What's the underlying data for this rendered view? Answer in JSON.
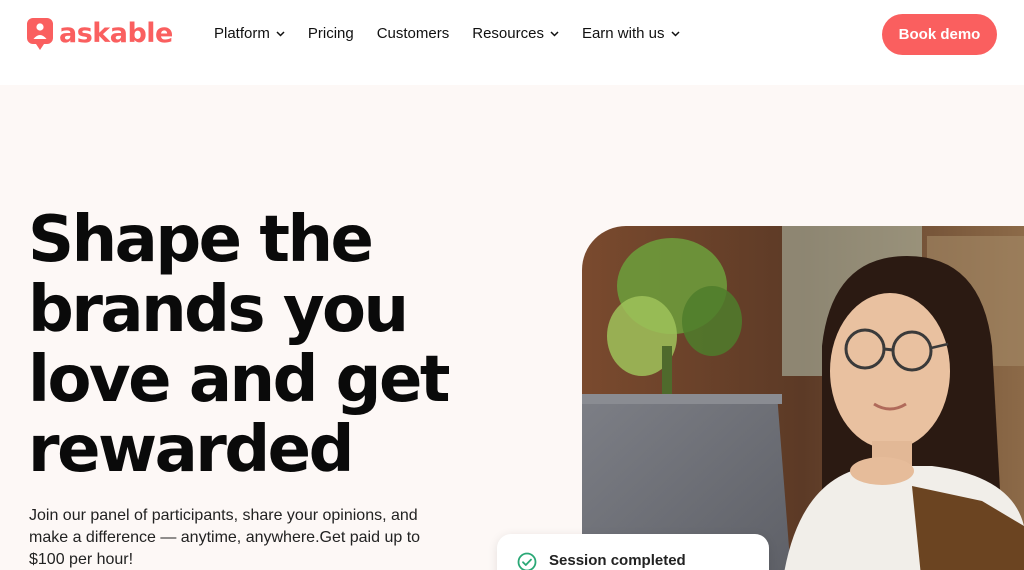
{
  "header": {
    "logo_text": "askable",
    "nav": [
      {
        "label": "Platform",
        "has_dropdown": true
      },
      {
        "label": "Pricing",
        "has_dropdown": false
      },
      {
        "label": "Customers",
        "has_dropdown": false
      },
      {
        "label": "Resources",
        "has_dropdown": true
      },
      {
        "label": "Earn with us",
        "has_dropdown": true
      }
    ],
    "cta_label": "Book demo"
  },
  "hero": {
    "headline_lines": [
      "Shape the",
      "brands you",
      "love and get",
      "rewarded"
    ],
    "subtext": "Join our panel of participants, share your opinions, and make a difference — anytime, anywhere.Get paid up to $100 per hour!",
    "toast_label": "Session completed",
    "toast_icon": "check-circle-icon"
  },
  "colors": {
    "brand": "#fa5f5f",
    "hero_bg": "#fdf8f6",
    "text": "#0a0a0a",
    "success": "#2aa876"
  }
}
